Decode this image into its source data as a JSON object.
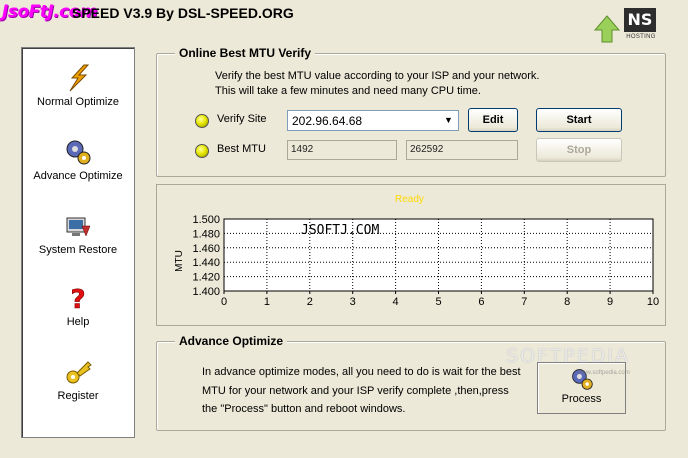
{
  "titlebar": {
    "logo_text": "JsoFtJ.com",
    "title": "SPEED V3.9 By DSL-SPEED.ORG",
    "badge_text": "NS",
    "badge_sub": "HOSTING"
  },
  "sidebar": {
    "items": [
      {
        "label": "Normal Optimize",
        "icon": "lightning-icon"
      },
      {
        "label": "Advance Optimize",
        "icon": "gears-icon"
      },
      {
        "label": "System Restore",
        "icon": "restore-icon"
      },
      {
        "label": "Help",
        "icon": "question-icon"
      },
      {
        "label": "Register",
        "icon": "key-icon"
      }
    ]
  },
  "mtu": {
    "title": "Online Best MTU Verify",
    "desc1": "Verify the best MTU value according to your ISP and your network.",
    "desc2": "This will take a few minutes and need many CPU time.",
    "verify_label": "Verify Site",
    "verify_value": "202.96.64.68",
    "edit_label": "Edit",
    "start_label": "Start",
    "best_label": "Best MTU",
    "best_value1": "1492",
    "best_value2": "262592",
    "stop_label": "Stop"
  },
  "chart_data": {
    "type": "line",
    "title": "Ready",
    "ylabel": "MTU",
    "xlabel": "",
    "watermark": "JSOFTJ.COM",
    "x_ticks": [
      0,
      1,
      2,
      3,
      4,
      5,
      6,
      7,
      8,
      9,
      10
    ],
    "y_ticks": [
      "1.500",
      "1.480",
      "1.460",
      "1.440",
      "1.420",
      "1.400"
    ],
    "xlim": [
      0,
      10
    ],
    "ylim": [
      1.4,
      1.5
    ],
    "grid": true,
    "series": [],
    "colors": {
      "plot_bg": "#ffffff",
      "frame_bg": "#ece9d8",
      "title": "#ffd800"
    }
  },
  "advance": {
    "title": "Advance Optimize",
    "desc1": "In advance optimize modes, all you need to do is wait for the best",
    "desc2": "MTU for your network and your ISP verify complete ,then,press",
    "desc3": "the \"Process\" button and reboot windows.",
    "process_label": "Process"
  },
  "watermark": {
    "text": "SOFTPEDIA",
    "sub": "www.softpedia.com"
  }
}
